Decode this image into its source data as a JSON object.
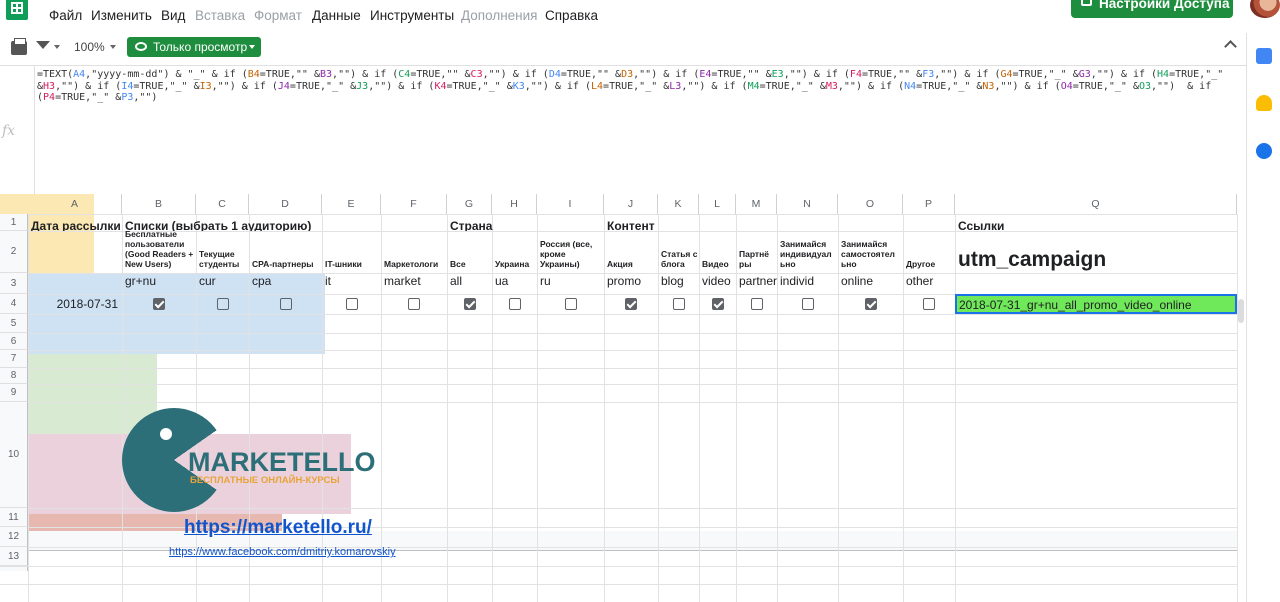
{
  "menu": [
    "Файл",
    "Изменить",
    "Вид",
    "Вставка",
    "Формат",
    "Данные",
    "Инструменты",
    "Дополнения",
    "Справка"
  ],
  "menu_disabled": [
    false,
    false,
    false,
    true,
    true,
    false,
    false,
    true,
    false
  ],
  "share_label": "Настройки Доступа",
  "toolbar": {
    "zoom": "100%",
    "view_only": "Только просмотр"
  },
  "formula": [
    "=TEXT(A4,\"yyyy-mm-dd\") & \"_\" & if (B4=TRUE,\"\" &B3,\"\") & if (C4=TRUE,\"\" &C3,\"\") & if (D4=TRUE,\"\" &D3,\"\") & if (E4=TRUE,\"\" &E3,\"\") & if (F4=TRUE,\"\" &F3,\"\") & if (G4=TRUE,\"_\" &G3,\"\") & if (H4=TRUE,\"_\"",
    "&H3,\"\") & if (I4=TRUE,\"_\" &I3,\"\") & if (J4=TRUE,\"_\" &J3,\"\") & if (K4=TRUE,\"_\" &K3,\"\") & if (L4=TRUE,\"_\" &L3,\"\") & if (M4=TRUE,\"_\" &M3,\"\") & if (N4=TRUE,\"_\" &N3,\"\") & if (O4=TRUE,\"_\" &O3,\"\")  & if",
    "(P4=TRUE,\"_\" &P3,\"\")"
  ],
  "fx_label": "fx",
  "columns": [
    "A",
    "B",
    "C",
    "D",
    "E",
    "F",
    "G",
    "H",
    "I",
    "J",
    "K",
    "L",
    "M",
    "N",
    "O",
    "P",
    "Q"
  ],
  "rows": [
    "1",
    "2",
    "3",
    "4",
    "5",
    "6",
    "7",
    "8",
    "9",
    "10",
    "11",
    "12",
    "13"
  ],
  "row1": {
    "A": "Дата рассылки",
    "B": "Списки (выбрать 1 аудиторию)",
    "G": "Страна",
    "J": "Контент",
    "Q": "Ссылки"
  },
  "row2": {
    "B": "Бесплатные пользователи (Good Readers + New Users)",
    "C": "Текущие студенты",
    "D": "CPA-партнеры",
    "E": "IT-шники",
    "F": "Маркетологи",
    "G": "Все",
    "H": "Украина",
    "I": "Россия (все, кроме Украины)",
    "J": "Акция",
    "K": "Статья с блога",
    "L": "Видео",
    "M": "Партнё ры",
    "N": "Занимайся индивидуал ьно",
    "O": "Занимайся самостоятел ьно",
    "P": "Другое",
    "Q": "utm_campaign"
  },
  "row3": {
    "B": "gr+nu",
    "C": "cur",
    "D": "cpa",
    "E": "it",
    "F": "market",
    "G": "all",
    "H": "ua",
    "I": "ru",
    "J": "promo",
    "K": "blog",
    "L": "video",
    "M": "partners",
    "N": "individ",
    "O": "online",
    "P": "other"
  },
  "row4": {
    "date": "2018-07-31",
    "checks": {
      "B": true,
      "C": false,
      "D": false,
      "E": false,
      "F": false,
      "G": true,
      "H": false,
      "I": false,
      "J": true,
      "K": false,
      "L": true,
      "M": false,
      "N": false,
      "O": true,
      "P": false
    },
    "result": "2018-07-31_gr+nu_all_promo_video_online"
  },
  "logo": {
    "name": "MARKETELLO",
    "tagline": "БЕСПЛАТНЫЕ ОНЛАЙН-КУРСЫ"
  },
  "links": {
    "site": "https://marketello.ru/",
    "facebook": "https://www.facebook.com/dmitriy.komarovskiy"
  },
  "colors": {
    "date_fill": "#fce8b2",
    "lists_fill": "#cfe2f3",
    "country_fill": "#d9ead3",
    "content_fill": "#ead1dc",
    "links_fill": "#e6b8af",
    "result_fill": "#6fe85a",
    "brand_teal": "#2d6f78",
    "brand_orange": "#e8a33a",
    "accent_green": "#1e8e3e"
  }
}
